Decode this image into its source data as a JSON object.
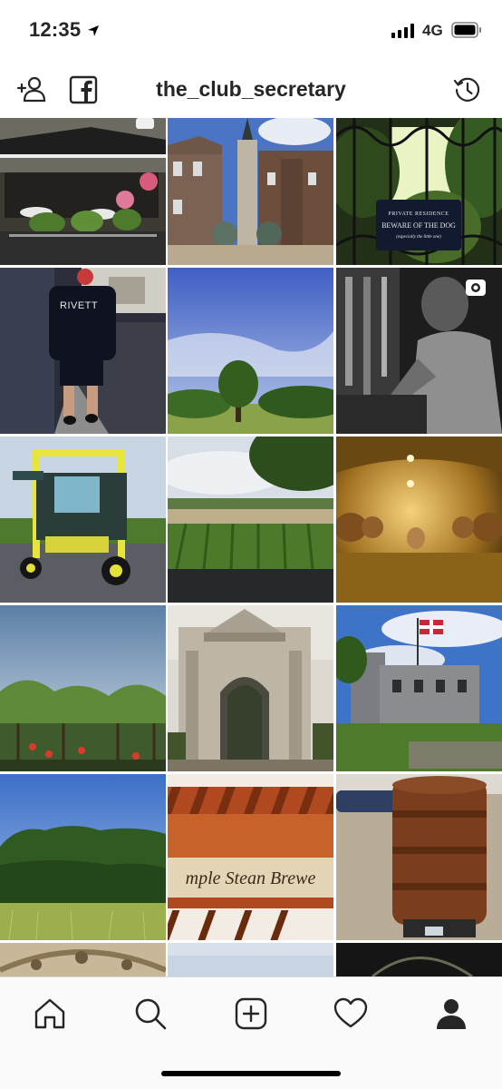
{
  "status_bar": {
    "time": "12:35",
    "network": "4G"
  },
  "header": {
    "username": "the_club_secretary"
  },
  "posts": [
    {
      "subject": "restaurant-terrace",
      "caption": ""
    },
    {
      "subject": "town-square-monument",
      "caption": ""
    },
    {
      "subject": "gate-sign",
      "caption": "",
      "sign": {
        "line1": "PRIVATE RESIDENCE",
        "line2": "BEWARE OF THE DOG",
        "line3": "(especially the little one)"
      }
    },
    {
      "subject": "man-walking-street",
      "caption": "",
      "shirt_text": "RIVETT"
    },
    {
      "subject": "tree-in-field",
      "caption": ""
    },
    {
      "subject": "workshop-man",
      "caption": "",
      "is_video": true
    },
    {
      "subject": "vineyard-tractor",
      "caption": ""
    },
    {
      "subject": "vineyard-rows",
      "caption": ""
    },
    {
      "subject": "wine-cellar-barrels",
      "caption": ""
    },
    {
      "subject": "grape-vines",
      "caption": ""
    },
    {
      "subject": "ornate-gateway",
      "caption": ""
    },
    {
      "subject": "castle-with-flag",
      "caption": ""
    },
    {
      "subject": "woodland-meadow",
      "caption": ""
    },
    {
      "subject": "brewery-sign",
      "caption": "",
      "sign_text": "mple Stean Brewe"
    },
    {
      "subject": "rusty-stove",
      "caption": ""
    },
    {
      "subject": "ceiling-partial",
      "caption": ""
    },
    {
      "subject": "sky-partial",
      "caption": ""
    },
    {
      "subject": "dark-partial",
      "caption": ""
    }
  ],
  "bottom_nav": {
    "items": [
      "home-icon",
      "search-icon",
      "add-post-icon",
      "heart-icon",
      "profile-icon"
    ]
  },
  "colors": {
    "accent_text": "#262626",
    "nav_background": "#fafafa",
    "divider": "#dbdbdb"
  }
}
